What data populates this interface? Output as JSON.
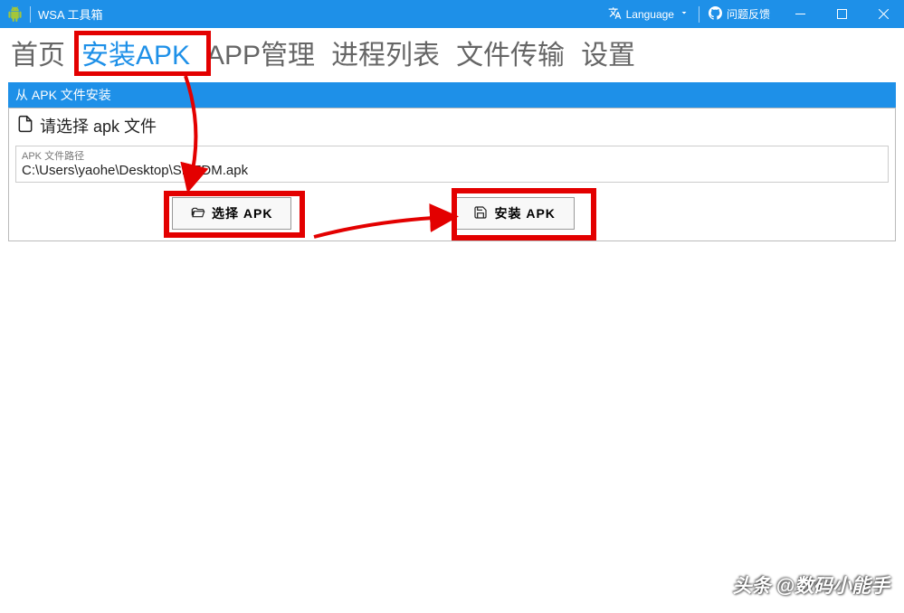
{
  "window": {
    "title": "WSA 工具箱",
    "language_label": "Language",
    "feedback_label": "问题反馈"
  },
  "tabs": {
    "items": [
      {
        "label": "首页"
      },
      {
        "label": "安装APK"
      },
      {
        "label": "APP管理"
      },
      {
        "label": "进程列表"
      },
      {
        "label": "文件传输"
      },
      {
        "label": "设置"
      }
    ],
    "active_index": 1
  },
  "section": {
    "header": "从 APK 文件安装",
    "panel_title": "请选择 apk 文件",
    "path_label": "APK 文件路径",
    "path_value": "C:\\Users\\yaohe\\Desktop\\SMZDM.apk",
    "select_btn": "选择 APK",
    "install_btn": "安装 APK"
  },
  "watermark": "头条 @数码小能手",
  "colors": {
    "primary": "#1e90e8",
    "highlight": "#e30000"
  },
  "icons": {
    "app": "android-icon",
    "language": "translate-icon",
    "feedback": "github-icon",
    "chevron": "chevron-down-icon",
    "document": "file-icon",
    "folder": "folder-open-icon",
    "save": "save-icon"
  }
}
